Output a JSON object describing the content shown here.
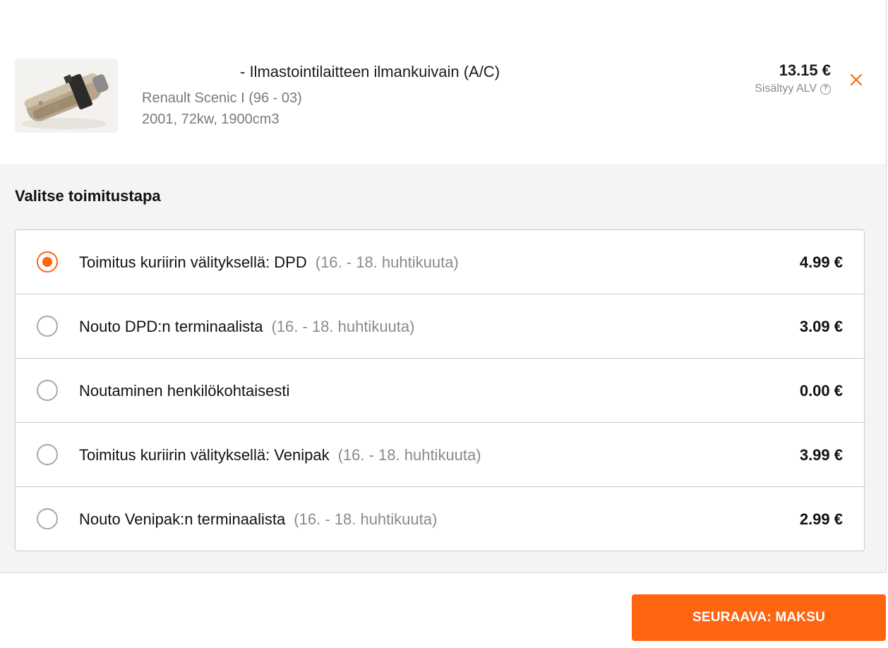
{
  "product": {
    "title": "- Ilmastointilaitteen ilmankuivain (A/C)",
    "car": "Renault Scenic I (96 - 03)",
    "spec": "2001, 72kw, 1900cm3",
    "price": "13.15 €",
    "vat_note": "Sisältyy ALV",
    "remove_icon": "close-icon",
    "image_icon": "part-photo"
  },
  "delivery": {
    "heading": "Valitse toimitustapa",
    "options": [
      {
        "label": "Toimitus kuriirin välityksellä: DPD",
        "date": "(16. - 18. huhtikuuta)",
        "price": "4.99 €",
        "selected": true
      },
      {
        "label": "Nouto DPD:n terminaalista",
        "date": "(16. - 18. huhtikuuta)",
        "price": "3.09 €",
        "selected": false
      },
      {
        "label": "Noutaminen henkilökohtaisesti",
        "date": "",
        "price": "0.00 €",
        "selected": false
      },
      {
        "label": "Toimitus kuriirin välityksellä: Venipak",
        "date": "(16. - 18. huhtikuuta)",
        "price": "3.99 €",
        "selected": false
      },
      {
        "label": "Nouto Venipak:n terminaalista",
        "date": "(16. - 18. huhtikuuta)",
        "price": "2.99 €",
        "selected": false
      }
    ]
  },
  "next_button": {
    "label": "SEURAAVA: MAKSU"
  },
  "colors": {
    "accent": "#ff6411",
    "section_bg": "#f4f4f4",
    "muted_text": "#8a8a8a"
  }
}
